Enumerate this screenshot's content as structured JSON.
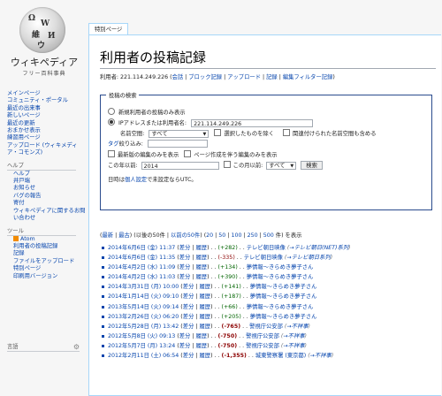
{
  "logo": {
    "name": "ウィキペディア",
    "tagline": "フリー百科事典",
    "glyphs": [
      "Ω",
      "W",
      "維",
      "И",
      "ウ"
    ]
  },
  "nav": {
    "main": [
      "メインページ",
      "コミュニティ・ポータル",
      "最近の出来事",
      "新しいページ",
      "最近の更新",
      "おまかせ表示",
      "練習用ページ",
      "アップロード (ウィキメディア・コモンズ)"
    ],
    "help_heading": "ヘルプ",
    "help": [
      "ヘルプ",
      "井戸端",
      "お知らせ",
      "バグの報告",
      "寄付",
      "ウィキペディアに関するお問い合わせ"
    ],
    "tools_heading": "ツール",
    "tools": [
      "Atom",
      "利用者の投稿記録",
      "記録",
      "ファイルをアップロード",
      "特別ページ",
      "印刷用バージョン"
    ],
    "lang_heading": "言語"
  },
  "tab": "特別ページ",
  "page": {
    "title": "利用者の投稿記録",
    "sub_ip": "利用者: 221.114.249.226",
    "sub_links": [
      "会話",
      "ブロック記録",
      "アップロード",
      "記録",
      "編集フィルター記録"
    ]
  },
  "form": {
    "legend": "投稿の検索",
    "radio_newbies": "新規利用者の投稿のみ表示",
    "radio_ip": "IPアドレスまたは利用者名:",
    "ip_value": "221.114.249.226",
    "namespace_label": "名前空間:",
    "namespace_value": "すべて",
    "invert_label": "選択したものを除く",
    "associated_label": "関連付けられた名前空間も含める",
    "tag_filter_link": "タグ",
    "tag_filter_text": "絞り込み:",
    "latest_only": "最新版の編集のみを表示",
    "creations_only": "ページ作成を伴う編集のみを表示",
    "year_label": "この年以前:",
    "year_value": "2014",
    "month_label": "この月以前:",
    "month_value": "すべて",
    "search_button": "検索",
    "tz_prefix": "日時は",
    "tz_link": "個人設定",
    "tz_suffix": "で未設定ならUTC。"
  },
  "pager": {
    "latest": "最新",
    "oldest": "最古",
    "newer": "以後の50件",
    "older": "以前の50件",
    "limits": [
      "20",
      "50",
      "100",
      "250",
      "500"
    ],
    "suffix": "件) を表示"
  },
  "contributions": [
    {
      "date": "2014年6月6日 (金) 11:37",
      "size": "+282",
      "size_class": "pos",
      "title": "テレビ朝日映像",
      "comment": "→テレビ朝日(NET)系列"
    },
    {
      "date": "2014年6月6日 (金) 11:35",
      "size": "-335",
      "size_class": "neg",
      "title": "テレビ朝日映像",
      "comment": "→テレビ朝日系列"
    },
    {
      "date": "2014年4月2日 (水) 11:09",
      "size": "+134",
      "size_class": "pos",
      "title": "夢情報〜きらめき夢子さん",
      "comment": ""
    },
    {
      "date": "2014年4月2日 (水) 11:03",
      "size": "+390",
      "size_class": "pos",
      "title": "夢情報〜きらめき夢子さん",
      "comment": ""
    },
    {
      "date": "2014年3月31日 (月) 10:00",
      "size": "+141",
      "size_class": "pos",
      "title": "夢情報〜きらめき夢子さん",
      "comment": ""
    },
    {
      "date": "2014年1月14日 (火) 09:10",
      "size": "+187",
      "size_class": "pos",
      "title": "夢情報〜きらめき夢子さん",
      "comment": ""
    },
    {
      "date": "2013年5月14日 (火) 09:14",
      "size": "+66",
      "size_class": "pos",
      "title": "夢情報〜きらめき夢子さん",
      "comment": ""
    },
    {
      "date": "2013年2月26日 (火) 06:20",
      "size": "+205",
      "size_class": "pos",
      "title": "夢情報〜きらめき夢子さん",
      "comment": ""
    },
    {
      "date": "2012年5月28日 (月) 13:42",
      "size": "-765",
      "size_class": "negb",
      "title": "警視庁公安部",
      "comment": "→不祥事"
    },
    {
      "date": "2012年5月8日 (火) 09:13",
      "size": "-750",
      "size_class": "negb",
      "title": "警視庁公安部",
      "comment": "→不祥事"
    },
    {
      "date": "2012年5月7日 (月) 13:24",
      "size": "-750",
      "size_class": "negb",
      "title": "警視庁公安部",
      "comment": "→不祥事"
    },
    {
      "date": "2012年2月11日 (土) 06:54",
      "size": "-1,355",
      "size_class": "negb",
      "title": "城東警察署 (東京都)",
      "comment": "→不祥事"
    }
  ],
  "row_labels": {
    "diff": "差分",
    "hist": "履歴"
  }
}
